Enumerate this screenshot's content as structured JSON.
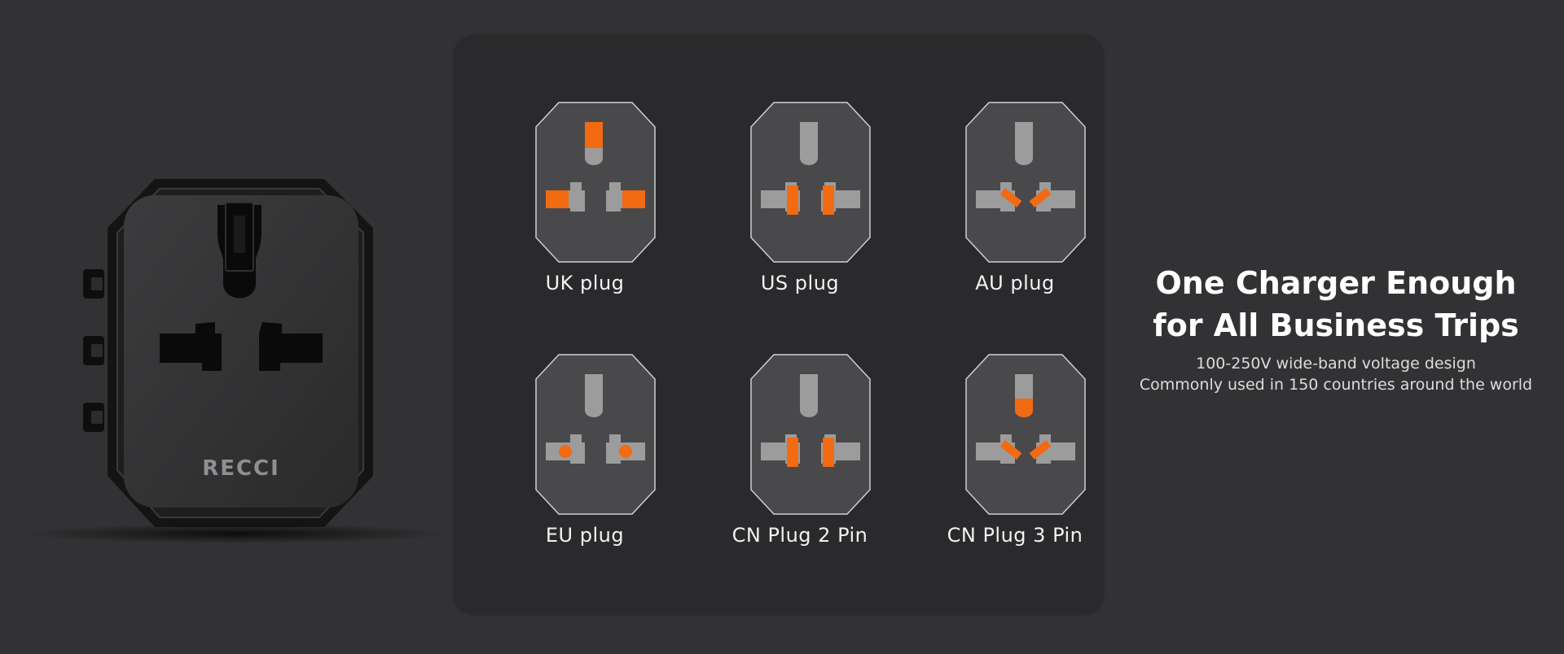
{
  "brand": {
    "logo_text": "RECCI",
    "accent_color": "#f26a12",
    "pin_color": "#9c9c9c",
    "outline_color": "#d0d0d0"
  },
  "plugs": [
    {
      "label": "UK plug",
      "icon": "uk-plug-icon",
      "highlight": "uk"
    },
    {
      "label": "US plug",
      "icon": "us-plug-icon",
      "highlight": "us"
    },
    {
      "label": "AU plug",
      "icon": "au-plug-icon",
      "highlight": "au"
    },
    {
      "label": "EU plug",
      "icon": "eu-plug-icon",
      "highlight": "eu"
    },
    {
      "label": "CN Plug 2 Pin",
      "icon": "cn2-plug-icon",
      "highlight": "cn2"
    },
    {
      "label": "CN Plug 3 Pin",
      "icon": "cn3-plug-icon",
      "highlight": "cn3"
    }
  ],
  "headline": {
    "line1": "One Charger Enough",
    "line2": "for All Business Trips"
  },
  "subtext": {
    "line1": "100-250V wide-band voltage design",
    "line2": "Commonly used in 150 countries around the world"
  }
}
